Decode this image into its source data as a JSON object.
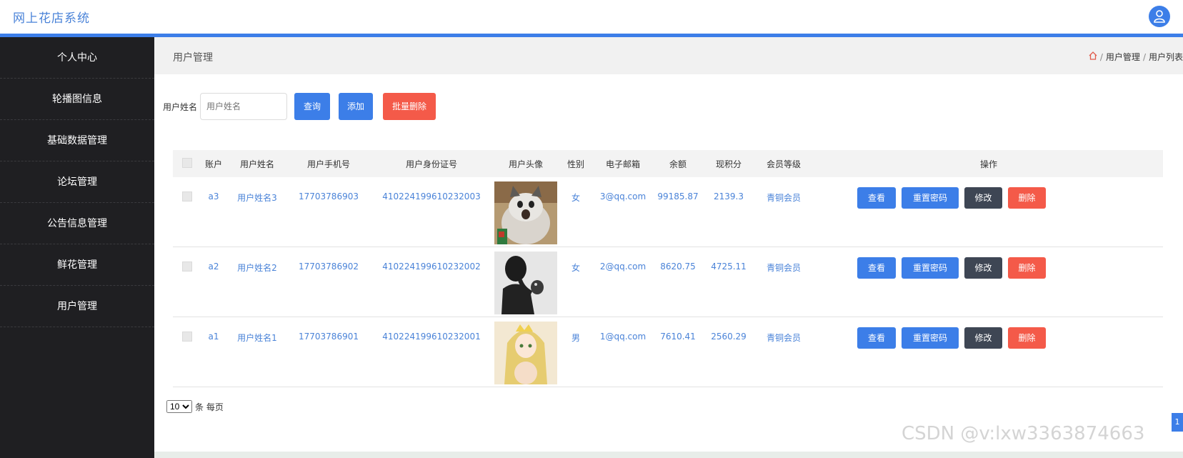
{
  "app": {
    "title": "网上花店系统"
  },
  "sidebar": {
    "items": [
      {
        "label": "个人中心"
      },
      {
        "label": "轮播图信息"
      },
      {
        "label": "基础数据管理"
      },
      {
        "label": "论坛管理"
      },
      {
        "label": "公告信息管理"
      },
      {
        "label": "鲜花管理"
      },
      {
        "label": "用户管理"
      }
    ]
  },
  "header": {
    "page_title": "用户管理",
    "breadcrumb": [
      "用户管理",
      "用户列表"
    ]
  },
  "search": {
    "label": "用户姓名",
    "placeholder": "用户姓名",
    "value": ""
  },
  "toolbar": {
    "query_label": "查询",
    "add_label": "添加",
    "batch_delete_label": "批量删除"
  },
  "table": {
    "columns": [
      "账户",
      "用户姓名",
      "用户手机号",
      "用户身份证号",
      "用户头像",
      "性别",
      "电子邮箱",
      "余额",
      "现积分",
      "会员等级",
      "操作"
    ],
    "rows": [
      {
        "account": "a3",
        "name": "用户姓名3",
        "phone": "17703786903",
        "id_card": "410224199610232003",
        "avatar": "cat-photo",
        "gender": "女",
        "email": "3@qq.com",
        "balance": "99185.87",
        "points": "2139.3",
        "level": "青铜会员"
      },
      {
        "account": "a2",
        "name": "用户姓名2",
        "phone": "17703786902",
        "id_card": "410224199610232002",
        "avatar": "silhouette-photo",
        "gender": "女",
        "email": "2@qq.com",
        "balance": "8620.75",
        "points": "4725.11",
        "level": "青铜会员"
      },
      {
        "account": "a1",
        "name": "用户姓名1",
        "phone": "17703786901",
        "id_card": "410224199610232001",
        "avatar": "anime-girl-photo",
        "gender": "男",
        "email": "1@qq.com",
        "balance": "7610.41",
        "points": "2560.29",
        "level": "青铜会员"
      }
    ],
    "actions": {
      "view": "查看",
      "reset": "重置密码",
      "edit": "修改",
      "delete": "删除"
    }
  },
  "pagination": {
    "page_size": "10",
    "suffix": "条 每页",
    "current_page": "1"
  },
  "watermark": "CSDN @v:lxw3363874663",
  "colors": {
    "primary": "#3c7ee8",
    "danger": "#f45a49",
    "dark": "#3e4654",
    "sidebar": "#1f1f22"
  }
}
